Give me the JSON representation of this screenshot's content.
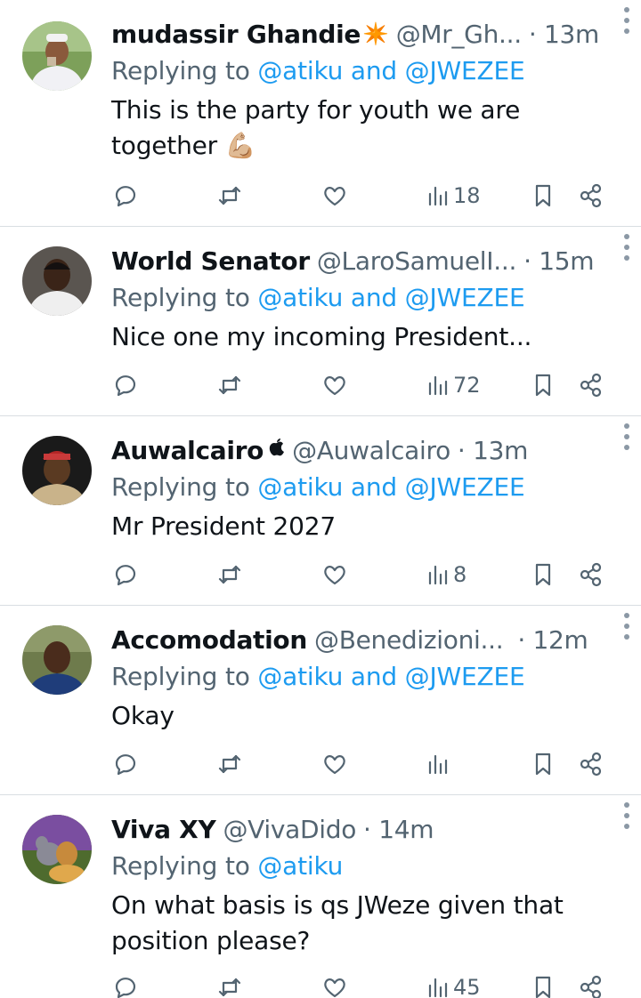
{
  "tweets": [
    {
      "name": "mudassir Ghandie",
      "badge": "✴️",
      "handle": "@Mr_Gh...",
      "time": "· 13m",
      "reply_prefix": "Replying to ",
      "reply_to": "@atiku and @JWEZEE",
      "text": "This is the party for youth we are together 💪🏼",
      "views": "18",
      "avatar_color": "#6c8f4e"
    },
    {
      "name": "World Senator",
      "badge": "",
      "handle": "@LaroSamuelI...",
      "time": "· 15m",
      "reply_prefix": "Replying to ",
      "reply_to": "@atiku and @JWEZEE",
      "text": "Nice one my incoming President...",
      "views": "72",
      "avatar_color": "#3d3a37"
    },
    {
      "name": "Auwalcairo",
      "badge": "",
      "handle": "@Auwalcairo",
      "time": "· 13m",
      "reply_prefix": "Replying to ",
      "reply_to": "@atiku and @JWEZEE",
      "text": "Mr President 2027",
      "views": "8",
      "avatar_color": "#2b2b2b"
    },
    {
      "name": "Accomodation",
      "badge": "",
      "handle": "@Benedizioni...",
      "time": "· 12m",
      "reply_prefix": "Replying to ",
      "reply_to": "@atiku and @JWEZEE",
      "text": "Okay",
      "views": "",
      "avatar_color": "#4d5c3a"
    },
    {
      "name": "Viva XY",
      "badge": "",
      "handle": "@VivaDido",
      "time": "· 14m",
      "reply_prefix": "Replying to ",
      "reply_to": "@atiku",
      "text": "On what basis is qs JWeze given that position please?",
      "views": "45",
      "avatar_color": "#7a5a2a"
    }
  ],
  "colors": {
    "link": "#1d9bf0",
    "muted": "#536471",
    "text": "#0f1419",
    "divider": "#d9dee2"
  }
}
